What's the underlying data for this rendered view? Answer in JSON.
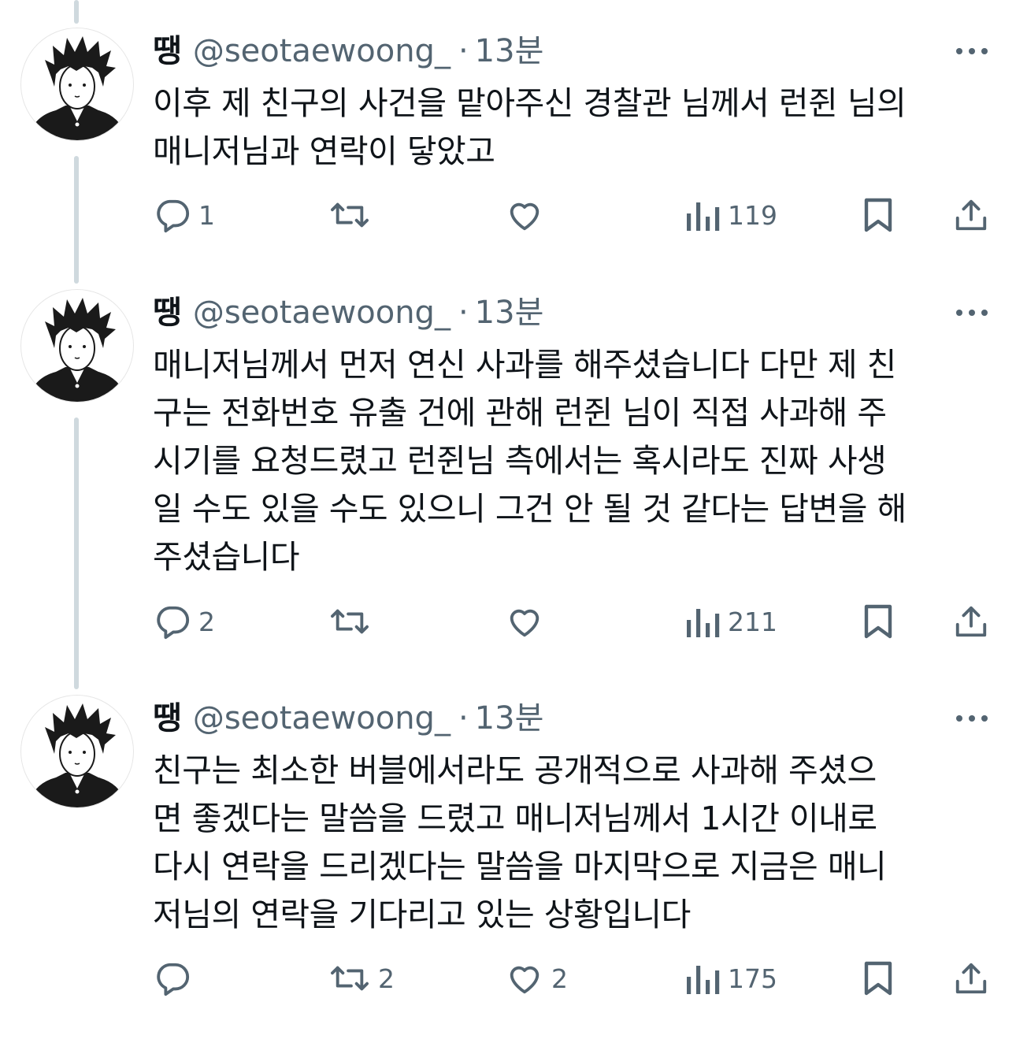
{
  "tweets": [
    {
      "display_name": "땡",
      "handle": "@seotaewoong_",
      "dot": "·",
      "time": "13분",
      "text": "이후 제 친구의 사건을 맡아주신 경찰관 님께서 런쥔 님의\n매니저님과 연락이 닿았고",
      "reply_count": "1",
      "retweet_count": "",
      "like_count": "",
      "view_count": "119"
    },
    {
      "display_name": "땡",
      "handle": "@seotaewoong_",
      "dot": "·",
      "time": "13분",
      "text": "매니저님께서 먼저 연신 사과를 해주셨습니다 다만 제 친\n구는 전화번호 유출 건에 관해 런쥔 님이 직접 사과해 주\n시기를 요청드렸고 런쥔님 측에서는 혹시라도 진짜 사생\n일 수도 있을 수도 있으니 그건 안 될 것 같다는 답변을 해\n주셨습니다",
      "reply_count": "2",
      "retweet_count": "",
      "like_count": "",
      "view_count": "211"
    },
    {
      "display_name": "땡",
      "handle": "@seotaewoong_",
      "dot": "·",
      "time": "13분",
      "text": "친구는 최소한 버블에서라도 공개적으로 사과해 주셨으\n면 좋겠다는 말씀을 드렸고 매니저님께서 1시간 이내로\n다시 연락을 드리겠다는 말씀을 마지막으로 지금은 매니\n저님의 연락을 기다리고 있는 상황입니다",
      "reply_count": "",
      "retweet_count": "2",
      "like_count": "2",
      "view_count": "175"
    }
  ],
  "icons": {
    "reply": "speech-bubble-icon",
    "retweet": "retweet-arrows-icon",
    "like": "heart-icon",
    "views": "bar-chart-icon",
    "bookmark": "bookmark-icon",
    "share": "share-upload-icon",
    "more": "more-dots-icon"
  },
  "colors": {
    "text": "#0f1419",
    "secondary": "#536471",
    "thread_line": "#cfd9de"
  }
}
